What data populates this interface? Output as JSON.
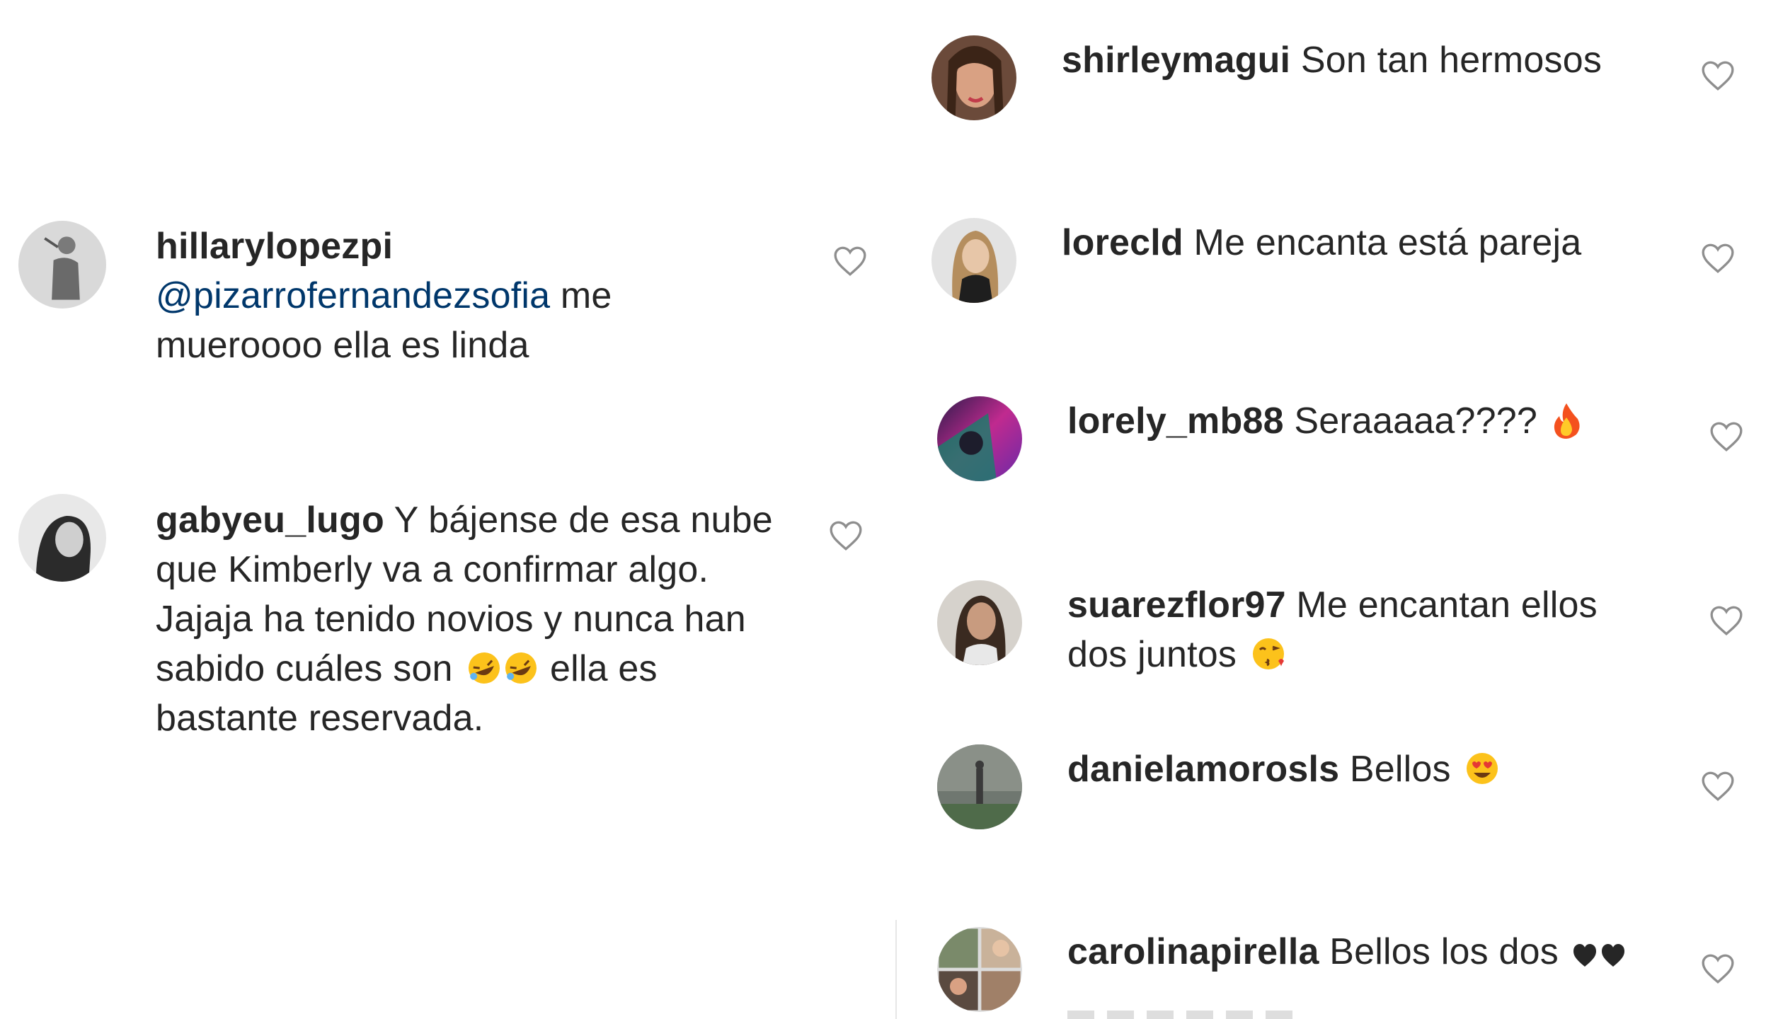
{
  "comments": [
    {
      "username": "hillarylopezpi",
      "mention": "@pizarrofernandezsofia",
      "text": " me mueroooo ella es linda"
    },
    {
      "username": "gabyeu_lugo",
      "text": " Y bájense de esa nube que Kimberly va a confirmar algo. Jajaja ha tenido novios y nunca han sabido cuáles son",
      "emoji": "rolling-on-floor-laughing-emoji x2",
      "text_after": " ella es bastante reservada."
    },
    {
      "username": "shirleymagui",
      "text": " Son tan hermosos"
    },
    {
      "username": "lorecld",
      "text": " Me encanta está pareja"
    },
    {
      "username": "lorely_mb88",
      "text": " Seraaaaa???? ",
      "emoji": "fire-emoji"
    },
    {
      "username": "suarezflor97",
      "text": " Me encantan ellos dos juntos",
      "emoji": "face-blowing-kiss-emoji"
    },
    {
      "username": "danielamorosls",
      "text": " Bellos",
      "emoji": "heart-eyes-emoji"
    },
    {
      "username": "carolinapirella",
      "text": " Bellos los dos ",
      "emoji": "black-hearts-emoji"
    }
  ],
  "colors": {
    "text": "#262626",
    "mention": "#00376b",
    "heart_outline": "#8e8e8e"
  }
}
